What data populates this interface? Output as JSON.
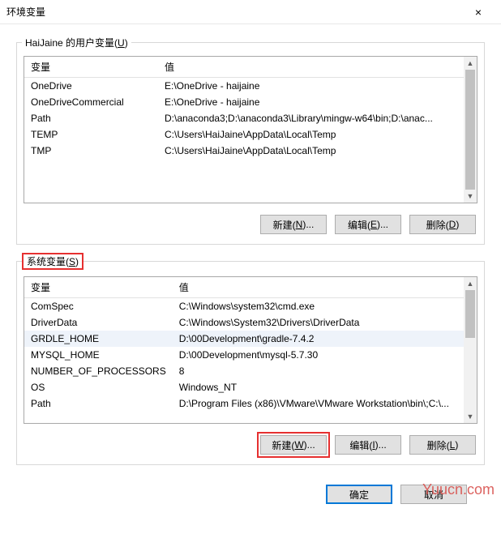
{
  "window": {
    "title": "环境变量",
    "close": "×"
  },
  "user_section": {
    "legend_pre": "HaiJaine 的用户变量(",
    "legend_u": "U",
    "legend_post": ")",
    "headers": {
      "name": "变量",
      "value": "值"
    },
    "rows": [
      {
        "name": "OneDrive",
        "value": "E:\\OneDrive - haijaine"
      },
      {
        "name": "OneDriveCommercial",
        "value": "E:\\OneDrive - haijaine"
      },
      {
        "name": "Path",
        "value": "D:\\anaconda3;D:\\anaconda3\\Library\\mingw-w64\\bin;D:\\anac..."
      },
      {
        "name": "TEMP",
        "value": "C:\\Users\\HaiJaine\\AppData\\Local\\Temp"
      },
      {
        "name": "TMP",
        "value": "C:\\Users\\HaiJaine\\AppData\\Local\\Temp"
      }
    ],
    "buttons": {
      "new_pre": "新建(",
      "new_u": "N",
      "new_post": ")...",
      "edit_pre": "编辑(",
      "edit_u": "E",
      "edit_post": ")...",
      "del_pre": "删除(",
      "del_u": "D",
      "del_post": ")"
    }
  },
  "sys_section": {
    "legend_pre": "系统变量(",
    "legend_u": "S",
    "legend_post": ")",
    "headers": {
      "name": "变量",
      "value": "值"
    },
    "rows": [
      {
        "name": "ComSpec",
        "value": "C:\\Windows\\system32\\cmd.exe"
      },
      {
        "name": "DriverData",
        "value": "C:\\Windows\\System32\\Drivers\\DriverData"
      },
      {
        "name": "GRDLE_HOME",
        "value": "D:\\00Development\\gradle-7.4.2",
        "selected": true
      },
      {
        "name": "MYSQL_HOME",
        "value": "D:\\00Development\\mysql-5.7.30"
      },
      {
        "name": "NUMBER_OF_PROCESSORS",
        "value": "8"
      },
      {
        "name": "OS",
        "value": "Windows_NT"
      },
      {
        "name": "Path",
        "value": "D:\\Program Files (x86)\\VMware\\VMware Workstation\\bin\\;C:\\..."
      }
    ],
    "buttons": {
      "new_pre": "新建(",
      "new_u": "W",
      "new_post": ")...",
      "edit_pre": "编辑(",
      "edit_u": "I",
      "edit_post": ")...",
      "del_pre": "删除(",
      "del_u": "L",
      "del_post": ")"
    }
  },
  "bottom": {
    "ok": "确定",
    "cancel": "取消"
  },
  "watermark": "Yuucn.com"
}
